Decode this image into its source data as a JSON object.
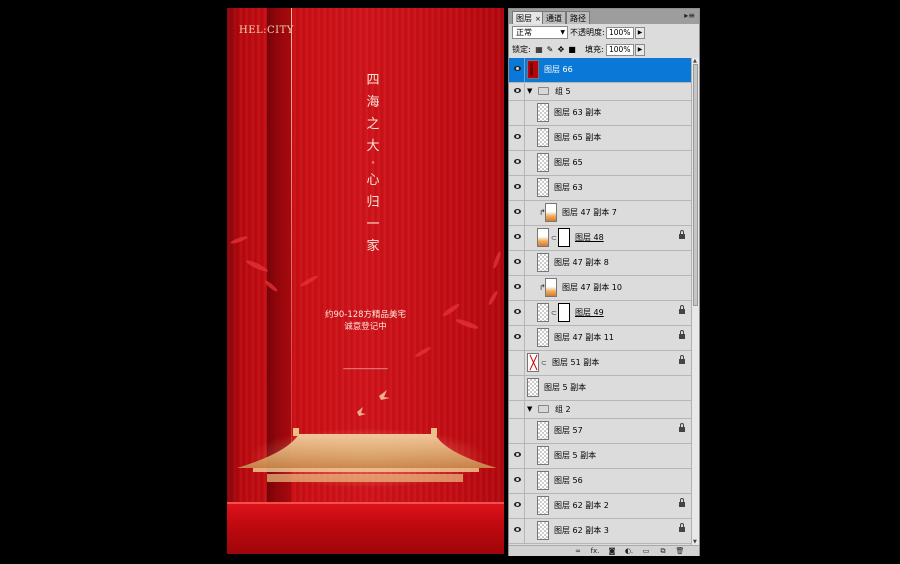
{
  "poster": {
    "logo": "HEL:CITY",
    "vertical_line1": [
      "四",
      "海",
      "之",
      "大"
    ],
    "vertical_dot": "•",
    "vertical_line2": [
      "心",
      "归",
      "一",
      "家"
    ],
    "subtitle1": "约90-128方精品美宅",
    "subtitle2": "诚意登记中"
  },
  "panel": {
    "tabs": [
      {
        "label": "图层",
        "active": true,
        "close": "×"
      },
      {
        "label": "通道",
        "active": false
      },
      {
        "label": "路径",
        "active": false
      }
    ],
    "menu_icon": "▸≡",
    "blend_mode": "正常",
    "opacity_label": "不透明度:",
    "opacity_value": "100%",
    "lock_label": "锁定:",
    "fill_label": "填充:",
    "fill_value": "100%",
    "lock_icons": [
      "lock-transparent-icon",
      "lock-paint-icon",
      "lock-move-icon",
      "lock-all-icon"
    ],
    "layers": [
      {
        "name": "图层 66",
        "type": "layer",
        "visible": true,
        "selected": true,
        "thumb": "red",
        "indent": 0
      },
      {
        "name": "组 5",
        "type": "group",
        "visible": true,
        "expanded": true
      },
      {
        "name": "图层 63 副本",
        "type": "layer",
        "visible": false,
        "thumb": "checker",
        "indent": 1
      },
      {
        "name": "图层 65 副本",
        "type": "layer",
        "visible": true,
        "thumb": "checker",
        "indent": 1
      },
      {
        "name": "图层 65",
        "type": "layer",
        "visible": true,
        "thumb": "checker",
        "indent": 1
      },
      {
        "name": "图层 63",
        "type": "layer",
        "visible": true,
        "thumb": "checker",
        "indent": 1
      },
      {
        "name": "图层 47 副本 7",
        "type": "layer",
        "visible": true,
        "thumb": "gold",
        "indent": 1,
        "clip": true
      },
      {
        "name": "图层 48",
        "type": "layer",
        "visible": true,
        "thumb": "gold",
        "mask": true,
        "underline": true,
        "locked": true,
        "indent": 1
      },
      {
        "name": "图层 47 副本 8",
        "type": "layer",
        "visible": true,
        "thumb": "checker",
        "indent": 1
      },
      {
        "name": "图层 47 副本 10",
        "type": "layer",
        "visible": true,
        "thumb": "gold",
        "indent": 1,
        "clip": true
      },
      {
        "name": "图层 49",
        "type": "layer",
        "visible": true,
        "thumb": "checker",
        "mask": true,
        "underline": true,
        "locked": true,
        "indent": 1
      },
      {
        "name": "图层 47 副本 11",
        "type": "layer",
        "visible": true,
        "thumb": "checker",
        "locked": true,
        "indent": 1
      },
      {
        "name": "图层 51 副本",
        "type": "layer",
        "visible": false,
        "thumb": "checker",
        "mask2": true,
        "locked": true,
        "indent": 0
      },
      {
        "name": "图层 5 副本",
        "type": "layer",
        "visible": false,
        "thumb": "checker",
        "indent": 0
      },
      {
        "name": "组 2",
        "type": "group",
        "visible": false,
        "expanded": true
      },
      {
        "name": "图层 57",
        "type": "layer",
        "visible": false,
        "thumb": "checker",
        "locked": true,
        "indent": 1
      },
      {
        "name": "图层 5 副本",
        "type": "layer",
        "visible": true,
        "thumb": "checker",
        "indent": 1
      },
      {
        "name": "图层 56",
        "type": "layer",
        "visible": true,
        "thumb": "checker",
        "indent": 1
      },
      {
        "name": "图层 62 副本 2",
        "type": "layer",
        "visible": true,
        "thumb": "checker",
        "locked": true,
        "indent": 1
      },
      {
        "name": "图层 62 副本 3",
        "type": "layer",
        "visible": true,
        "thumb": "checker",
        "locked": true,
        "indent": 1
      }
    ],
    "footer_buttons": [
      {
        "name": "link-layers-icon",
        "glyph": "∞"
      },
      {
        "name": "fx-icon",
        "glyph": "fx."
      },
      {
        "name": "add-mask-icon",
        "glyph": "◙"
      },
      {
        "name": "adjustment-layer-icon",
        "glyph": "◐."
      },
      {
        "name": "new-group-icon",
        "glyph": "▭"
      },
      {
        "name": "new-layer-icon",
        "glyph": "⧉"
      },
      {
        "name": "trash-icon",
        "glyph": "🗑"
      }
    ]
  }
}
